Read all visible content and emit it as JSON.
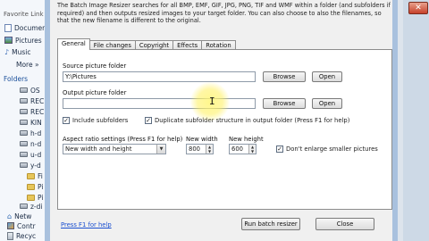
{
  "explorer": {
    "favorites_label": "Favorite Link",
    "links": [
      {
        "label": "Documen",
        "icon": "documents-icon"
      },
      {
        "label": "Pictures",
        "icon": "pictures-icon"
      },
      {
        "label": "Music",
        "icon": "music-icon"
      }
    ],
    "more_label": "More »",
    "folders_label": "Folders",
    "tree": [
      {
        "label": "OS",
        "icon": "drive-icon"
      },
      {
        "label": "REC",
        "icon": "drive-icon"
      },
      {
        "label": "REC",
        "icon": "drive-icon"
      },
      {
        "label": "KIN",
        "icon": "drive-icon"
      },
      {
        "label": "h-d",
        "icon": "drive-icon"
      },
      {
        "label": "n-d",
        "icon": "drive-icon"
      },
      {
        "label": "u-d",
        "icon": "drive-icon"
      },
      {
        "label": "y-d",
        "icon": "drive-icon"
      },
      {
        "label": "Fi",
        "icon": "folder-icon"
      },
      {
        "label": "Pi",
        "icon": "folder-icon"
      },
      {
        "label": "Pi",
        "icon": "folder-icon"
      },
      {
        "label": "z-di",
        "icon": "drive-icon"
      },
      {
        "label": "Netw",
        "icon": "network-icon"
      },
      {
        "label": "Contr",
        "icon": "control-panel-icon"
      },
      {
        "label": "Recyc",
        "icon": "recycle-bin-icon"
      }
    ]
  },
  "dialog": {
    "intro": "The Batch Image Resizer searches for all BMP, EMF, GIF, JPG, PNG, TIF and WMF within a folder (and subfolders if required) and then outputs resized images to your target folder. You can also choose to also the filenames, so that the new filename is different to the original.",
    "tabs": [
      "General",
      "File changes",
      "Copyright",
      "Effects",
      "Rotation"
    ],
    "source_label": "Source picture folder",
    "source_value": "Y:\\Pictures",
    "output_label": "Output picture folder",
    "output_value": "",
    "browse_label": "Browse",
    "open_label": "Open",
    "include_subfolders": "Include subfolders",
    "duplicate_structure": "Duplicate subfolder structure in output folder (Press F1 for help)",
    "aspect_label": "Aspect ratio settings (Press F1 for help)",
    "aspect_value": "New width and height",
    "new_width_label": "New width",
    "new_width_value": "800",
    "new_height_label": "New height",
    "new_height_value": "600",
    "dont_enlarge": "Don't enlarge smaller pictures",
    "help_link": "Press F1 for help",
    "run_label": "Run batch resizer",
    "close_label": "Close",
    "checkmark": "✓"
  },
  "window": {
    "close_glyph": "✕"
  },
  "colors": {
    "accent_border": "#a9c1de",
    "link": "#1a4fd0",
    "highlight": "#fff066"
  }
}
